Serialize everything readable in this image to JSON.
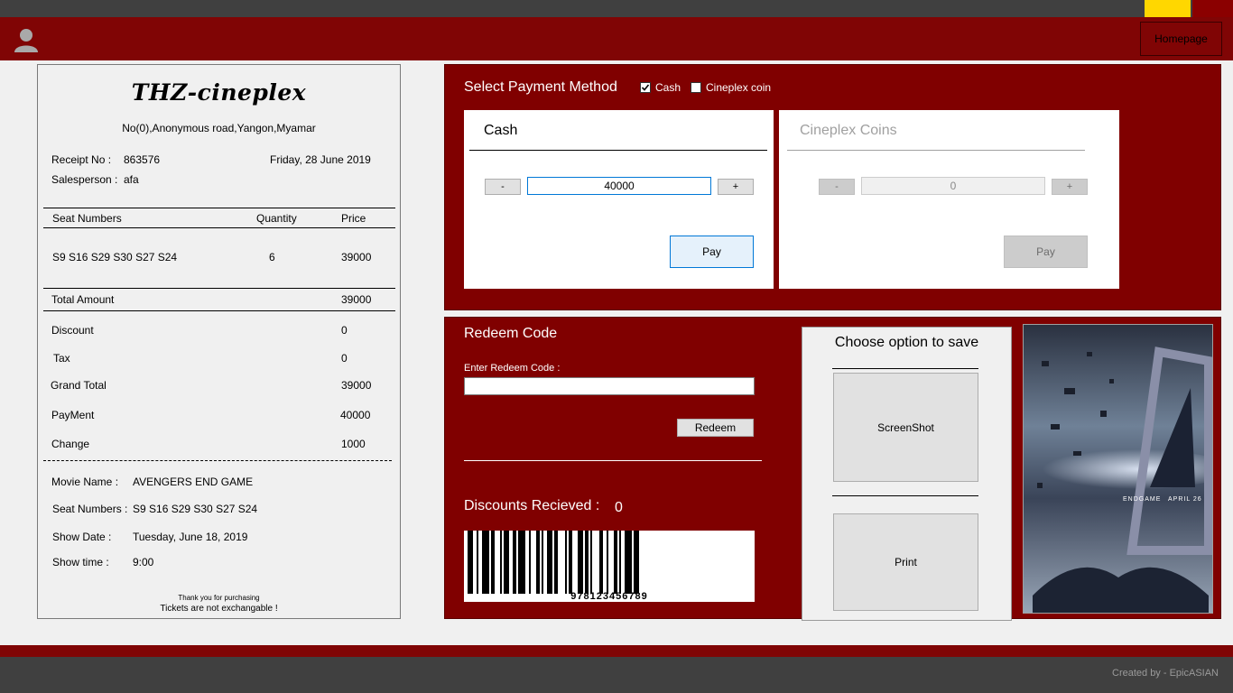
{
  "header": {
    "homepage_label": "Homepage",
    "avatar_icon": "user-icon"
  },
  "receipt": {
    "title": "THZ-cineplex",
    "address": "No(0),Anonymous road,Yangon,Myamar",
    "receipt_no_label": "Receipt No :",
    "receipt_no": "863576",
    "date": "Friday, 28 June 2019",
    "salesperson_label": "Salesperson :",
    "salesperson": "afa",
    "col_seat": "Seat Numbers",
    "col_qty": "Quantity",
    "col_price": "Price",
    "row_seats": "S9  S16 S29 S30 S27 S24",
    "row_qty": "6",
    "row_price": "39000",
    "total_label": "Total Amount",
    "total": "39000",
    "discount_label": "Discount",
    "discount": "0",
    "tax_label": "Tax",
    "tax": "0",
    "grand_total_label": "Grand Total",
    "grand_total": "39000",
    "payment_label": "PayMent",
    "payment": "40000",
    "change_label": "Change",
    "change": "1000",
    "movie_label": "Movie Name :",
    "movie": "AVENGERS END GAME",
    "seat_label": "Seat Numbers :",
    "seats": "S9  S16 S29 S30 S27 S24",
    "show_date_label": "Show Date :",
    "show_date": "Tuesday, June 18, 2019",
    "show_time_label": "Show time :",
    "show_time": "9:00",
    "thanks": "Thank you for purchasing",
    "notice": "Tickets are not exchangable !"
  },
  "payment": {
    "title": "Select Payment Method",
    "opt_cash": "Cash",
    "opt_cash_checked": true,
    "opt_coin": "Cineplex coin",
    "opt_coin_checked": false,
    "cash": {
      "title": "Cash",
      "minus": "-",
      "plus": "+",
      "value": "40000",
      "pay": "Pay"
    },
    "coins": {
      "title": "Cineplex Coins",
      "minus": "-",
      "plus": "+",
      "value": "0",
      "pay": "Pay"
    }
  },
  "redeem": {
    "title": "Redeem Code",
    "enter_label": "Enter Redeem Code :",
    "code_value": "",
    "redeem_button": "Redeem",
    "discounts_label": "Discounts Recieved :",
    "discounts_value": "0",
    "barcode_number": "978123456789"
  },
  "save": {
    "title": "Choose option to save",
    "screenshot": "ScreenShot",
    "print": "Print"
  },
  "poster": {
    "line1": "ENDGAME",
    "line2": "APRIL 26"
  },
  "footer": {
    "credit": "Created by - EpicASIAN"
  },
  "colors": {
    "accent": "#800000",
    "header": "#800505",
    "chrome": "#404040",
    "highlight": "#ffd700"
  }
}
